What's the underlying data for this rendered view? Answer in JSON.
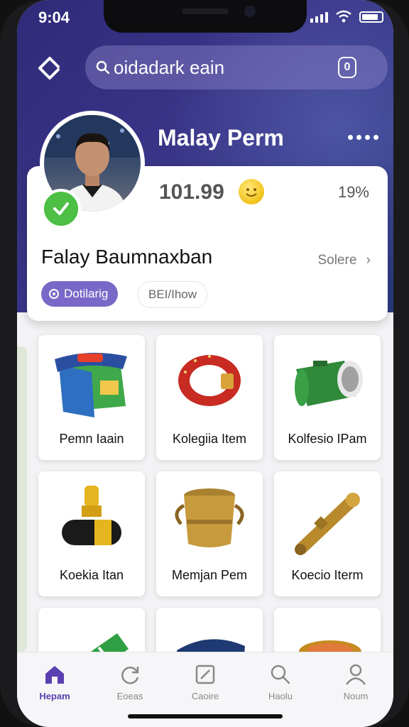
{
  "status_bar": {
    "time": "9:04"
  },
  "search": {
    "placeholder": "oidadark eain",
    "badge": "0"
  },
  "profile": {
    "name": "Malay Perm",
    "stat_value": "101.99",
    "percent": "19%",
    "title": "Falay Baumnaxban",
    "see_more": "Solere",
    "tag_primary": "Dotilarig",
    "tag_secondary": "BEI/Ihow"
  },
  "items": [
    {
      "label": "Pemn Iaain",
      "icon": "box-icon"
    },
    {
      "label": "Kolegiia Item",
      "icon": "bracelet-icon"
    },
    {
      "label": "Kolfesio IPam",
      "icon": "cylinder-icon"
    },
    {
      "label": "Koekia Itan",
      "icon": "figure-icon"
    },
    {
      "label": "Memjan Pem",
      "icon": "pot-icon"
    },
    {
      "label": "Koecio Iterm",
      "icon": "tube-icon"
    },
    {
      "label": "",
      "icon": "green-item-icon"
    },
    {
      "label": "",
      "icon": "blue-box-icon"
    },
    {
      "label": "",
      "icon": "jar-icon"
    }
  ],
  "tabs": [
    {
      "label": "Hepam",
      "icon": "home-icon",
      "active": true
    },
    {
      "label": "Eoeas",
      "icon": "refresh-icon",
      "active": false
    },
    {
      "label": "Caoire",
      "icon": "edit-icon",
      "active": false
    },
    {
      "label": "Haolu",
      "icon": "search-icon",
      "active": false
    },
    {
      "label": "Noum",
      "icon": "user-icon",
      "active": false
    }
  ],
  "colors": {
    "header": "#2f2a78",
    "accent": "#7a68c8",
    "verified": "#4cbf44"
  }
}
